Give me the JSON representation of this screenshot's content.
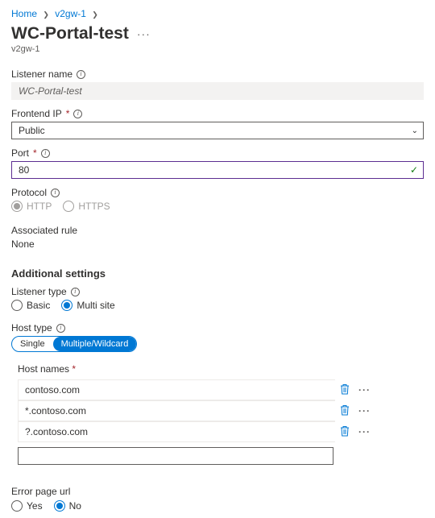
{
  "breadcrumb": {
    "home": "Home",
    "parent": "v2gw-1"
  },
  "title": "WC-Portal-test",
  "resource_subtitle": "v2gw-1",
  "listener_name": {
    "label": "Listener name",
    "value": "WC-Portal-test"
  },
  "frontend_ip": {
    "label": "Frontend IP",
    "value": "Public"
  },
  "port": {
    "label": "Port",
    "value": "80"
  },
  "protocol": {
    "label": "Protocol",
    "http": "HTTP",
    "https": "HTTPS"
  },
  "assoc_rule": {
    "label": "Associated rule",
    "value": "None"
  },
  "additional_header": "Additional settings",
  "listener_type": {
    "label": "Listener type",
    "basic": "Basic",
    "multi": "Multi site"
  },
  "host_type": {
    "label": "Host type",
    "single": "Single",
    "multi": "Multiple/Wildcard"
  },
  "hostnames": {
    "label": "Host names",
    "items": [
      "contoso.com",
      "*.contoso.com",
      "?.contoso.com"
    ]
  },
  "error_page": {
    "label": "Error page url",
    "yes": "Yes",
    "no": "No"
  }
}
